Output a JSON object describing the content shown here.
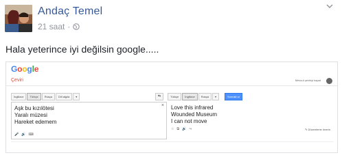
{
  "post": {
    "author": "Andaç Temel",
    "time": "21 saat",
    "separator": "·",
    "text": "Hala yeterince iyi değilsin google....."
  },
  "screenshot": {
    "logo_letters": [
      {
        "ch": "G",
        "color": "#4285f4"
      },
      {
        "ch": "o",
        "color": "#ea4335"
      },
      {
        "ch": "o",
        "color": "#fbbc05"
      },
      {
        "ch": "g",
        "color": "#4285f4"
      },
      {
        "ch": "l",
        "color": "#34a853"
      },
      {
        "ch": "e",
        "color": "#ea4335"
      }
    ],
    "page_label": "Çeviri",
    "feedback": "Mevcut çeviriyi kapat",
    "source_langs": [
      "İngilizce",
      "Türkçe",
      "Rusça",
      "Dili algıla",
      "▾"
    ],
    "target_langs": [
      "Türkçe",
      "İngilizce",
      "Rusça",
      "▾"
    ],
    "swap_icon": "⇆",
    "translate_label": "Sonraki ol",
    "source_text": "Aşk bu kızılötesi\nYaralı müzesi\nHareket edemem",
    "clear_icon": "×",
    "source_icons": [
      "🎤",
      "🔊",
      "⌨"
    ],
    "target_text": "Love this infrared\nWounded Museum\nI can not move",
    "target_icons": [
      "☆",
      "⧉",
      "🔊",
      "⤳"
    ],
    "suggest_edit": "✎ Düzenleme önerin"
  }
}
